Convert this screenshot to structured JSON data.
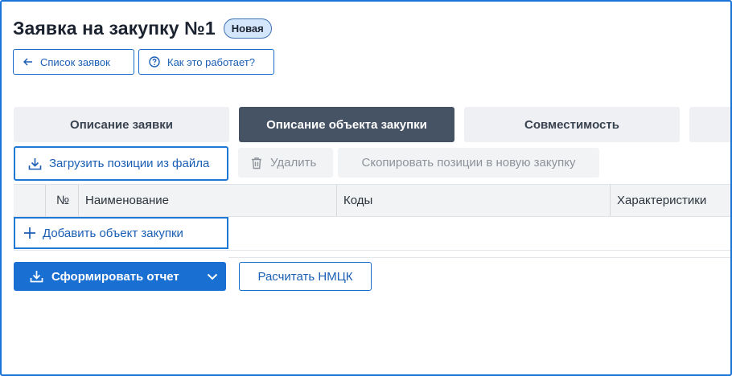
{
  "header": {
    "title": "Заявка на закупку №1",
    "status": "Новая"
  },
  "nav": {
    "back_label": "Список заявок",
    "help_label": "Как это работает?"
  },
  "tabs": [
    {
      "label": "Описание заявки",
      "active": false
    },
    {
      "label": "Описание объекта закупки",
      "active": true
    },
    {
      "label": "Совместимость",
      "active": false
    },
    {
      "label": "",
      "active": false
    }
  ],
  "toolbar": {
    "load_label": "Загрузить позиции из файла",
    "delete_label": "Удалить",
    "copy_label": "Скопировать позиции в новую закупку"
  },
  "table": {
    "columns": [
      "",
      "№",
      "Наименование",
      "Коды",
      "Характеристики"
    ],
    "add_label": "Добавить объект закупки"
  },
  "actions": {
    "report_label": "Сформировать отчет",
    "nmck_label": "Расчитать НМЦК"
  },
  "colors": {
    "accent": "#1a6fd2",
    "active_tab": "#465364",
    "badge_bg": "#d4e6fb",
    "frame": "#1a74d8"
  },
  "icons": {
    "back": "arrow-left-icon",
    "help": "question-circle-icon",
    "load": "download-icon",
    "delete": "trash-icon",
    "add": "plus-icon",
    "report": "download-icon",
    "report_menu": "chevron-down-icon"
  }
}
